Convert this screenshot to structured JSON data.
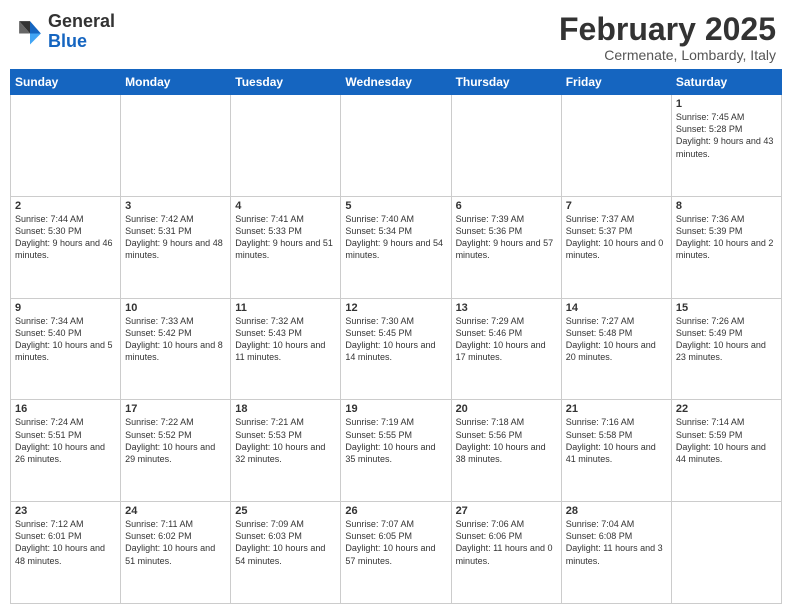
{
  "logo": {
    "general": "General",
    "blue": "Blue"
  },
  "header": {
    "title": "February 2025",
    "subtitle": "Cermenate, Lombardy, Italy"
  },
  "weekdays": [
    "Sunday",
    "Monday",
    "Tuesday",
    "Wednesday",
    "Thursday",
    "Friday",
    "Saturday"
  ],
  "weeks": [
    [
      {
        "day": "",
        "info": ""
      },
      {
        "day": "",
        "info": ""
      },
      {
        "day": "",
        "info": ""
      },
      {
        "day": "",
        "info": ""
      },
      {
        "day": "",
        "info": ""
      },
      {
        "day": "",
        "info": ""
      },
      {
        "day": "1",
        "info": "Sunrise: 7:45 AM\nSunset: 5:28 PM\nDaylight: 9 hours and 43 minutes."
      }
    ],
    [
      {
        "day": "2",
        "info": "Sunrise: 7:44 AM\nSunset: 5:30 PM\nDaylight: 9 hours and 46 minutes."
      },
      {
        "day": "3",
        "info": "Sunrise: 7:42 AM\nSunset: 5:31 PM\nDaylight: 9 hours and 48 minutes."
      },
      {
        "day": "4",
        "info": "Sunrise: 7:41 AM\nSunset: 5:33 PM\nDaylight: 9 hours and 51 minutes."
      },
      {
        "day": "5",
        "info": "Sunrise: 7:40 AM\nSunset: 5:34 PM\nDaylight: 9 hours and 54 minutes."
      },
      {
        "day": "6",
        "info": "Sunrise: 7:39 AM\nSunset: 5:36 PM\nDaylight: 9 hours and 57 minutes."
      },
      {
        "day": "7",
        "info": "Sunrise: 7:37 AM\nSunset: 5:37 PM\nDaylight: 10 hours and 0 minutes."
      },
      {
        "day": "8",
        "info": "Sunrise: 7:36 AM\nSunset: 5:39 PM\nDaylight: 10 hours and 2 minutes."
      }
    ],
    [
      {
        "day": "9",
        "info": "Sunrise: 7:34 AM\nSunset: 5:40 PM\nDaylight: 10 hours and 5 minutes."
      },
      {
        "day": "10",
        "info": "Sunrise: 7:33 AM\nSunset: 5:42 PM\nDaylight: 10 hours and 8 minutes."
      },
      {
        "day": "11",
        "info": "Sunrise: 7:32 AM\nSunset: 5:43 PM\nDaylight: 10 hours and 11 minutes."
      },
      {
        "day": "12",
        "info": "Sunrise: 7:30 AM\nSunset: 5:45 PM\nDaylight: 10 hours and 14 minutes."
      },
      {
        "day": "13",
        "info": "Sunrise: 7:29 AM\nSunset: 5:46 PM\nDaylight: 10 hours and 17 minutes."
      },
      {
        "day": "14",
        "info": "Sunrise: 7:27 AM\nSunset: 5:48 PM\nDaylight: 10 hours and 20 minutes."
      },
      {
        "day": "15",
        "info": "Sunrise: 7:26 AM\nSunset: 5:49 PM\nDaylight: 10 hours and 23 minutes."
      }
    ],
    [
      {
        "day": "16",
        "info": "Sunrise: 7:24 AM\nSunset: 5:51 PM\nDaylight: 10 hours and 26 minutes."
      },
      {
        "day": "17",
        "info": "Sunrise: 7:22 AM\nSunset: 5:52 PM\nDaylight: 10 hours and 29 minutes."
      },
      {
        "day": "18",
        "info": "Sunrise: 7:21 AM\nSunset: 5:53 PM\nDaylight: 10 hours and 32 minutes."
      },
      {
        "day": "19",
        "info": "Sunrise: 7:19 AM\nSunset: 5:55 PM\nDaylight: 10 hours and 35 minutes."
      },
      {
        "day": "20",
        "info": "Sunrise: 7:18 AM\nSunset: 5:56 PM\nDaylight: 10 hours and 38 minutes."
      },
      {
        "day": "21",
        "info": "Sunrise: 7:16 AM\nSunset: 5:58 PM\nDaylight: 10 hours and 41 minutes."
      },
      {
        "day": "22",
        "info": "Sunrise: 7:14 AM\nSunset: 5:59 PM\nDaylight: 10 hours and 44 minutes."
      }
    ],
    [
      {
        "day": "23",
        "info": "Sunrise: 7:12 AM\nSunset: 6:01 PM\nDaylight: 10 hours and 48 minutes."
      },
      {
        "day": "24",
        "info": "Sunrise: 7:11 AM\nSunset: 6:02 PM\nDaylight: 10 hours and 51 minutes."
      },
      {
        "day": "25",
        "info": "Sunrise: 7:09 AM\nSunset: 6:03 PM\nDaylight: 10 hours and 54 minutes."
      },
      {
        "day": "26",
        "info": "Sunrise: 7:07 AM\nSunset: 6:05 PM\nDaylight: 10 hours and 57 minutes."
      },
      {
        "day": "27",
        "info": "Sunrise: 7:06 AM\nSunset: 6:06 PM\nDaylight: 11 hours and 0 minutes."
      },
      {
        "day": "28",
        "info": "Sunrise: 7:04 AM\nSunset: 6:08 PM\nDaylight: 11 hours and 3 minutes."
      },
      {
        "day": "",
        "info": ""
      }
    ]
  ]
}
